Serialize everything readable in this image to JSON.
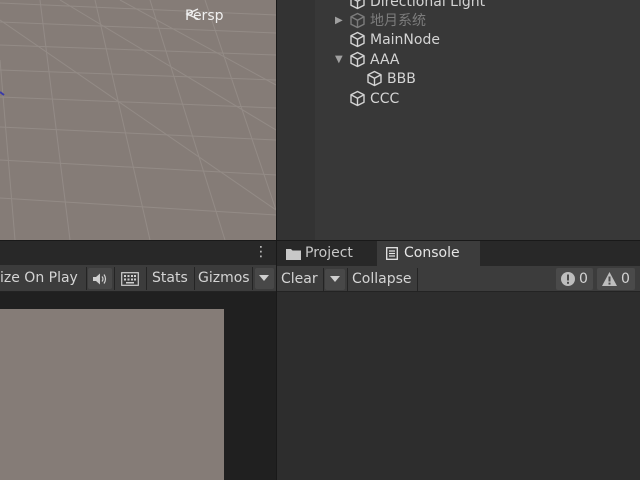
{
  "scene_view": {
    "camera_label": "Persp"
  },
  "hierarchy": {
    "items": [
      {
        "label": "Directional Light",
        "disabled": false,
        "arrow": ""
      },
      {
        "label": "地月系统",
        "disabled": true,
        "arrow": "▶"
      },
      {
        "label": "MainNode",
        "disabled": false,
        "arrow": ""
      },
      {
        "label": "AAA",
        "disabled": false,
        "arrow": "▼"
      },
      {
        "label": "BBB",
        "disabled": false,
        "arrow": ""
      },
      {
        "label": "CCC",
        "disabled": false,
        "arrow": ""
      }
    ]
  },
  "game_view": {
    "maximize_label": "ize On Play",
    "stats_label": "Stats",
    "gizmos_label": "Gizmos",
    "menu_glyph": "⋮"
  },
  "console": {
    "tabs": [
      {
        "label": "Project",
        "active": false
      },
      {
        "label": "Console",
        "active": true
      }
    ],
    "clear_label": "Clear",
    "collapse_label": "Collapse",
    "error_count": "0",
    "warning_count": "0"
  },
  "colors": {
    "scene_bg": "#857c77",
    "panel_bg": "#383838",
    "toolbar_bg": "#3c3c3c"
  }
}
